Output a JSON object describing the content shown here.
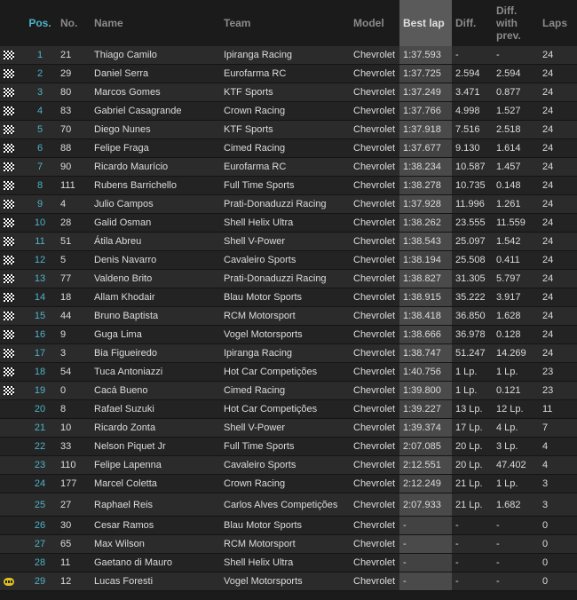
{
  "table": {
    "headers": {
      "pos": "Pos.",
      "no": "No.",
      "name": "Name",
      "team": "Team",
      "model": "Model",
      "best_lap": "Best lap",
      "diff": "Diff.",
      "diff_prev": "Diff. with prev.",
      "laps": "Laps"
    },
    "rows": [
      {
        "flag": "checkered-flag-icon",
        "pos": "1",
        "no": "21",
        "name": "Thiago Camilo",
        "team": "Ipiranga Racing",
        "model": "Chevrolet",
        "best_lap": "1:37.593",
        "diff": "-",
        "diff_prev": "-",
        "laps": "24"
      },
      {
        "flag": "checkered-flag-icon",
        "pos": "2",
        "no": "29",
        "name": "Daniel Serra",
        "team": "Eurofarma RC",
        "model": "Chevrolet",
        "best_lap": "1:37.725",
        "diff": "2.594",
        "diff_prev": "2.594",
        "laps": "24"
      },
      {
        "flag": "checkered-flag-icon",
        "pos": "3",
        "no": "80",
        "name": "Marcos Gomes",
        "team": "KTF Sports",
        "model": "Chevrolet",
        "best_lap": "1:37.249",
        "diff": "3.471",
        "diff_prev": "0.877",
        "laps": "24"
      },
      {
        "flag": "checkered-flag-icon",
        "pos": "4",
        "no": "83",
        "name": "Gabriel Casagrande",
        "team": "Crown Racing",
        "model": "Chevrolet",
        "best_lap": "1:37.766",
        "diff": "4.998",
        "diff_prev": "1.527",
        "laps": "24"
      },
      {
        "flag": "checkered-flag-icon",
        "pos": "5",
        "no": "70",
        "name": "Diego Nunes",
        "team": "KTF Sports",
        "model": "Chevrolet",
        "best_lap": "1:37.918",
        "diff": "7.516",
        "diff_prev": "2.518",
        "laps": "24"
      },
      {
        "flag": "checkered-flag-icon",
        "pos": "6",
        "no": "88",
        "name": "Felipe Fraga",
        "team": "Cimed Racing",
        "model": "Chevrolet",
        "best_lap": "1:37.677",
        "diff": "9.130",
        "diff_prev": "1.614",
        "laps": "24"
      },
      {
        "flag": "checkered-flag-icon",
        "pos": "7",
        "no": "90",
        "name": "Ricardo Maurício",
        "team": "Eurofarma RC",
        "model": "Chevrolet",
        "best_lap": "1:38.234",
        "diff": "10.587",
        "diff_prev": "1.457",
        "laps": "24"
      },
      {
        "flag": "checkered-flag-icon",
        "pos": "8",
        "no": "111",
        "name": "Rubens Barrichello",
        "team": "Full Time Sports",
        "model": "Chevrolet",
        "best_lap": "1:38.278",
        "diff": "10.735",
        "diff_prev": "0.148",
        "laps": "24"
      },
      {
        "flag": "checkered-flag-icon",
        "pos": "9",
        "no": "4",
        "name": "Julio Campos",
        "team": "Prati-Donaduzzi Racing",
        "model": "Chevrolet",
        "best_lap": "1:37.928",
        "diff": "11.996",
        "diff_prev": "1.261",
        "laps": "24"
      },
      {
        "flag": "checkered-flag-icon",
        "pos": "10",
        "no": "28",
        "name": "Galid Osman",
        "team": "Shell Helix Ultra",
        "model": "Chevrolet",
        "best_lap": "1:38.262",
        "diff": "23.555",
        "diff_prev": "11.559",
        "laps": "24"
      },
      {
        "flag": "checkered-flag-icon",
        "pos": "11",
        "no": "51",
        "name": "Átila Abreu",
        "team": "Shell V-Power",
        "model": "Chevrolet",
        "best_lap": "1:38.543",
        "diff": "25.097",
        "diff_prev": "1.542",
        "laps": "24"
      },
      {
        "flag": "checkered-flag-icon",
        "pos": "12",
        "no": "5",
        "name": "Denis Navarro",
        "team": "Cavaleiro Sports",
        "model": "Chevrolet",
        "best_lap": "1:38.194",
        "diff": "25.508",
        "diff_prev": "0.411",
        "laps": "24"
      },
      {
        "flag": "checkered-flag-icon",
        "pos": "13",
        "no": "77",
        "name": "Valdeno Brito",
        "team": "Prati-Donaduzzi Racing",
        "model": "Chevrolet",
        "best_lap": "1:38.827",
        "diff": "31.305",
        "diff_prev": "5.797",
        "laps": "24"
      },
      {
        "flag": "checkered-flag-icon",
        "pos": "14",
        "no": "18",
        "name": "Allam Khodair",
        "team": "Blau Motor Sports",
        "model": "Chevrolet",
        "best_lap": "1:38.915",
        "diff": "35.222",
        "diff_prev": "3.917",
        "laps": "24"
      },
      {
        "flag": "checkered-flag-icon",
        "pos": "15",
        "no": "44",
        "name": "Bruno Baptista",
        "team": "RCM Motorsport",
        "model": "Chevrolet",
        "best_lap": "1:38.418",
        "diff": "36.850",
        "diff_prev": "1.628",
        "laps": "24"
      },
      {
        "flag": "checkered-flag-icon",
        "pos": "16",
        "no": "9",
        "name": "Guga Lima",
        "team": "Vogel Motorsports",
        "model": "Chevrolet",
        "best_lap": "1:38.666",
        "diff": "36.978",
        "diff_prev": "0.128",
        "laps": "24"
      },
      {
        "flag": "checkered-flag-icon",
        "pos": "17",
        "no": "3",
        "name": "Bia Figueiredo",
        "team": "Ipiranga Racing",
        "model": "Chevrolet",
        "best_lap": "1:38.747",
        "diff": "51.247",
        "diff_prev": "14.269",
        "laps": "24"
      },
      {
        "flag": "checkered-flag-icon",
        "pos": "18",
        "no": "54",
        "name": "Tuca Antoniazzi",
        "team": "Hot Car Competições",
        "model": "Chevrolet",
        "best_lap": "1:40.756",
        "diff": "1 Lp.",
        "diff_prev": "1 Lp.",
        "laps": "23"
      },
      {
        "flag": "checkered-flag-icon",
        "pos": "19",
        "no": "0",
        "name": "Cacá Bueno",
        "team": "Cimed Racing",
        "model": "Chevrolet",
        "best_lap": "1:39.800",
        "diff": "1 Lp.",
        "diff_prev": "0.121",
        "laps": "23"
      },
      {
        "flag": "",
        "pos": "20",
        "no": "8",
        "name": "Rafael Suzuki",
        "team": "Hot Car Competições",
        "model": "Chevrolet",
        "best_lap": "1:39.227",
        "diff": "13 Lp.",
        "diff_prev": "12 Lp.",
        "laps": "11"
      },
      {
        "flag": "",
        "pos": "21",
        "no": "10",
        "name": "Ricardo Zonta",
        "team": "Shell V-Power",
        "model": "Chevrolet",
        "best_lap": "1:39.374",
        "diff": "17 Lp.",
        "diff_prev": "4 Lp.",
        "laps": "7"
      },
      {
        "flag": "",
        "pos": "22",
        "no": "33",
        "name": "Nelson Piquet Jr",
        "team": "Full Time Sports",
        "model": "Chevrolet",
        "best_lap": "2:07.085",
        "diff": "20 Lp.",
        "diff_prev": "3 Lp.",
        "laps": "4"
      },
      {
        "flag": "",
        "pos": "23",
        "no": "110",
        "name": "Felipe Lapenna",
        "team": "Cavaleiro Sports",
        "model": "Chevrolet",
        "best_lap": "2:12.551",
        "diff": "20 Lp.",
        "diff_prev": "47.402",
        "laps": "4"
      },
      {
        "flag": "",
        "pos": "24",
        "no": "177",
        "name": "Marcel Coletta",
        "team": "Crown Racing",
        "model": "Chevrolet",
        "best_lap": "2:12.249",
        "diff": "21 Lp.",
        "diff_prev": "1 Lp.",
        "laps": "3"
      },
      {
        "flag": "",
        "pos": "25",
        "no": "27",
        "name": "Raphael Reis",
        "team": "Carlos Alves Competições",
        "model": "Chevrolet",
        "best_lap": "2:07.933",
        "diff": "21 Lp.",
        "diff_prev": "1.682",
        "laps": "3"
      },
      {
        "flag": "",
        "pos": "26",
        "no": "30",
        "name": "Cesar Ramos",
        "team": "Blau Motor Sports",
        "model": "Chevrolet",
        "best_lap": "-",
        "diff": "-",
        "diff_prev": "-",
        "laps": "0"
      },
      {
        "flag": "",
        "pos": "27",
        "no": "65",
        "name": "Max Wilson",
        "team": "RCM Motorsport",
        "model": "Chevrolet",
        "best_lap": "-",
        "diff": "-",
        "diff_prev": "-",
        "laps": "0"
      },
      {
        "flag": "",
        "pos": "28",
        "no": "11",
        "name": "Gaetano di Mauro",
        "team": "Shell Helix Ultra",
        "model": "Chevrolet",
        "best_lap": "-",
        "diff": "-",
        "diff_prev": "-",
        "laps": "0"
      },
      {
        "flag": "pit-icon",
        "pos": "29",
        "no": "12",
        "name": "Lucas Foresti",
        "team": "Vogel Motorsports",
        "model": "Chevrolet",
        "best_lap": "-",
        "diff": "-",
        "diff_prev": "-",
        "laps": "0"
      }
    ]
  },
  "colors": {
    "accent": "#4fb3c8",
    "background": "#1b1b1b",
    "row_odd": "#2b2b2b",
    "row_even": "#232323",
    "best_lap_column": "#4a4a4a"
  }
}
